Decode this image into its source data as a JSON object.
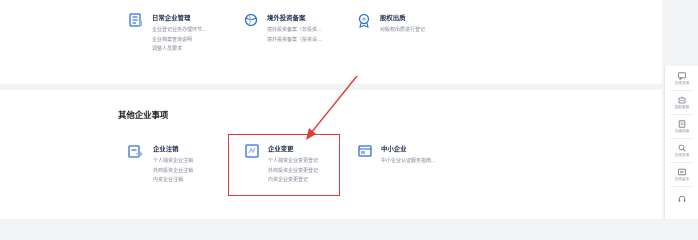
{
  "top_row": [
    {
      "title": "日常企业管理",
      "icon": "building-icon",
      "lines": [
        "企业登记业务办理环节...",
        "企业档案查询说明",
        "调整人员要求"
      ]
    },
    {
      "title": "境外投资备案",
      "icon": "globe-icon",
      "lines": [
        "境外投资备案（非投资...",
        "境外投资备案（投资设..."
      ]
    },
    {
      "title": "股权出质",
      "icon": "equity-icon",
      "lines": [
        "对股权出质进行登记"
      ]
    }
  ],
  "section_title": "其他企业事项",
  "bottom_row": [
    {
      "title": "企业注销",
      "icon": "deregister-icon",
      "lines": [
        "个人独资企业注销",
        "外商投资企业注销",
        "内资企业注销"
      ]
    },
    {
      "title": "企业变更",
      "icon": "change-icon",
      "lines": [
        "个人独资企业变更登记",
        "外商投资企业变更登记",
        "内资企业变更登记"
      ]
    },
    {
      "title": "中小企业",
      "icon": "sme-icon",
      "lines": [
        "中小企业认证服务指南..."
      ]
    }
  ],
  "side_rail": [
    {
      "label": "在线咨询",
      "icon": "chat-icon"
    },
    {
      "label": "智能客服",
      "icon": "robot-icon"
    },
    {
      "label": "办事指南",
      "icon": "book-icon"
    },
    {
      "label": "在线查询",
      "icon": "search-icon"
    },
    {
      "label": "在线留言",
      "icon": "message-icon"
    },
    {
      "label": "",
      "icon": "headset-icon"
    }
  ],
  "colors": {
    "accent": "#2f6fd6",
    "highlight": "#e23a32"
  }
}
